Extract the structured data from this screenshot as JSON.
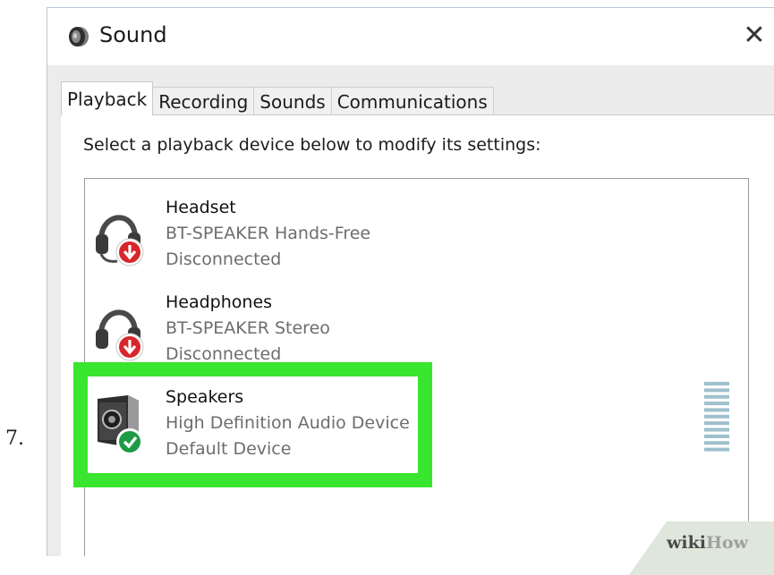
{
  "step": {
    "number": "7."
  },
  "window": {
    "title": "Sound",
    "title_icon": "speaker-icon",
    "close_label": "✕"
  },
  "tabs": [
    {
      "label": "Playback",
      "active": true
    },
    {
      "label": "Recording",
      "active": false
    },
    {
      "label": "Sounds",
      "active": false
    },
    {
      "label": "Communications",
      "active": false
    }
  ],
  "instruction": "Select a playback device below to modify its settings:",
  "devices": [
    {
      "name": "Headset",
      "description": "BT-SPEAKER Hands-Free",
      "status": "Disconnected",
      "icon": "headset-disconnected-icon",
      "status_color": "#d8262a"
    },
    {
      "name": "Headphones",
      "description": "BT-SPEAKER Stereo",
      "status": "Disconnected",
      "icon": "headphones-disconnected-icon",
      "status_color": "#d8262a"
    },
    {
      "name": "Speakers",
      "description": "High Definition Audio Device",
      "status": "Default Device",
      "icon": "speakers-default-icon",
      "status_color": "#1e9b47",
      "highlighted": true,
      "level_meter_bars": 11
    }
  ],
  "colors": {
    "highlight": "#39e52e",
    "meter": "#9fc0cc"
  },
  "watermark": {
    "text_a": "wiki",
    "text_b": "How"
  }
}
